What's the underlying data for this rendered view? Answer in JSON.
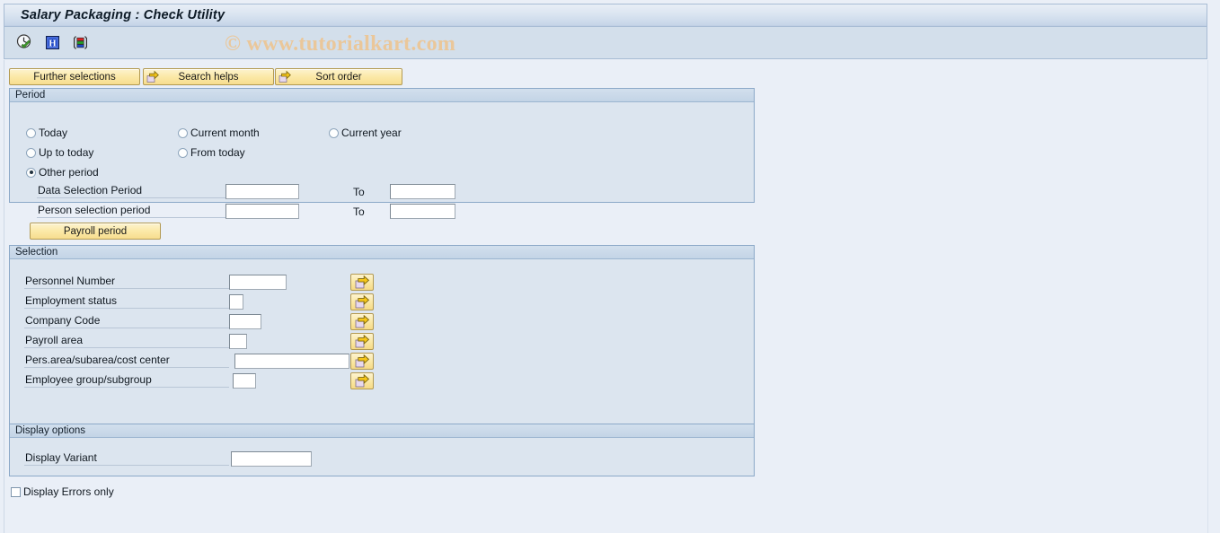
{
  "window": {
    "title": "Salary Packaging : Check Utility"
  },
  "watermark": {
    "text": "© www.tutorialkart.com"
  },
  "toolbar": {
    "icons": [
      {
        "name": "execute-clock-icon",
        "tooltip": "Execute"
      },
      {
        "name": "info-help-icon",
        "tooltip": "Information"
      },
      {
        "name": "variant-stripes-icon",
        "tooltip": "Get Variant"
      }
    ]
  },
  "buttons": {
    "further_selections": "Further selections",
    "search_helps": "Search helps",
    "sort_order": "Sort order",
    "payroll_period": "Payroll period"
  },
  "period": {
    "title": "Period",
    "radios": [
      {
        "label": "Today",
        "selected": false
      },
      {
        "label": "Current month",
        "selected": false
      },
      {
        "label": "Current year",
        "selected": false
      },
      {
        "label": "Up to today",
        "selected": false
      },
      {
        "label": "From today",
        "selected": false
      },
      {
        "label": "Other period",
        "selected": true
      }
    ],
    "rows": [
      {
        "label": "Data Selection Period",
        "value": "",
        "to_label": "To",
        "to_value": ""
      },
      {
        "label": "Person selection period",
        "value": "",
        "to_label": "To",
        "to_value": ""
      }
    ]
  },
  "selection": {
    "title": "Selection",
    "rows": [
      {
        "label": "Personnel Number",
        "value": ""
      },
      {
        "label": "Employment status",
        "value": ""
      },
      {
        "label": "Company Code",
        "value": ""
      },
      {
        "label": "Payroll area",
        "value": ""
      },
      {
        "label": "Pers.area/subarea/cost center",
        "value": ""
      },
      {
        "label": "Employee group/subgroup",
        "value": ""
      }
    ],
    "multi_select_icon": "multiple-selection-arrow-icon"
  },
  "display_options": {
    "title": "Display options",
    "variant_label": "Display Variant",
    "variant_value": ""
  },
  "display_errors": {
    "label": "Display Errors only",
    "checked": false
  },
  "colors": {
    "title_bar": "#dbe5f1",
    "toolbar_band": "#d3dfeb",
    "panel_bg": "#dce5ef",
    "panel_border": "#8ca9c8",
    "canvas_bg": "#eaeff7",
    "button_yellow": "#fbe9a8",
    "button_border": "#b39a52",
    "watermark": "#eac79a"
  }
}
